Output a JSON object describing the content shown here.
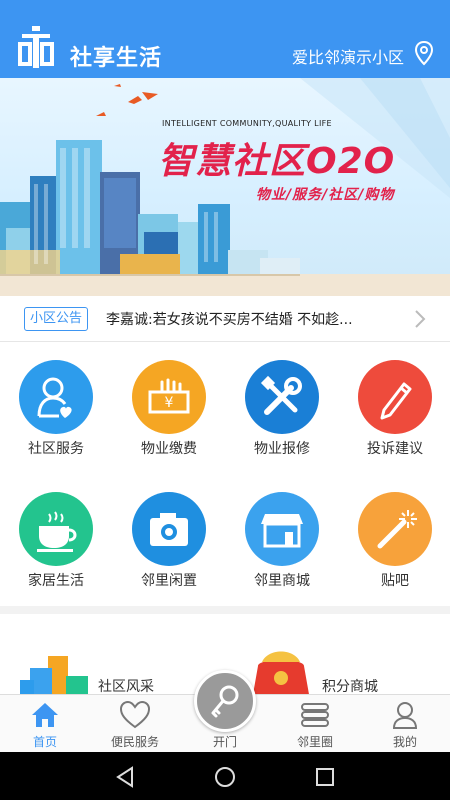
{
  "header": {
    "title": "社享生活",
    "community": "爱比邻演示小区",
    "colors": {
      "bar": "#3d95f2"
    }
  },
  "banner": {
    "en_text": "INTELLIGENT COMMUNITY,QUALITY LIFE",
    "title": "智慧社区O2O",
    "subtitle": "物业/服务/社区/购物"
  },
  "notice": {
    "tag": "小区公告",
    "text": "李嘉诚:若女孩说不买房不结婚 不如趁..."
  },
  "services": [
    {
      "label": "社区服务",
      "icon": "person-heart-icon",
      "color": "#2d9cec"
    },
    {
      "label": "物业缴费",
      "icon": "money-hand-icon",
      "color": "#f5a623"
    },
    {
      "label": "物业报修",
      "icon": "tools-icon",
      "color": "#1a7fd6"
    },
    {
      "label": "投诉建议",
      "icon": "pencil-icon",
      "color": "#ee4b3c"
    },
    {
      "label": "家居生活",
      "icon": "coffee-cup-icon",
      "color": "#23c48e"
    },
    {
      "label": "邻里闲置",
      "icon": "camera-icon",
      "color": "#1f8fe0"
    },
    {
      "label": "邻里商城",
      "icon": "shop-icon",
      "color": "#3ba2ee"
    },
    {
      "label": "贴吧",
      "icon": "magic-wand-icon",
      "color": "#f7a23b"
    }
  ],
  "lower": {
    "left_label": "社区风采",
    "right_label": "积分商城"
  },
  "tabs": [
    {
      "label": "首页",
      "icon": "home-icon",
      "active": true
    },
    {
      "label": "便民服务",
      "icon": "heart-icon",
      "active": false
    },
    {
      "label": "开门",
      "icon": "key-icon",
      "active": false
    },
    {
      "label": "邻里圈",
      "icon": "layers-icon",
      "active": false
    },
    {
      "label": "我的",
      "icon": "user-icon",
      "active": false
    }
  ]
}
